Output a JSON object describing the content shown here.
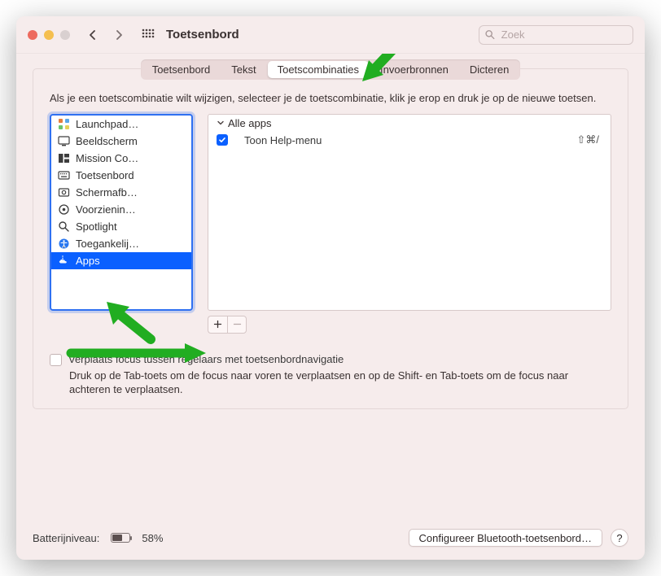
{
  "window": {
    "title": "Toetsenbord"
  },
  "search": {
    "placeholder": "Zoek"
  },
  "tabs": [
    "Toetsenbord",
    "Tekst",
    "Toetscombinaties",
    "Invoerbronnen",
    "Dicteren"
  ],
  "active_tab_index": 2,
  "description": "Als je een toetscombinatie wilt wijzigen, selecteer je de toetscombinatie, klik je erop en druk je op de nieuwe toetsen.",
  "categories": [
    {
      "label": "Launchpad…",
      "icon": "launchpad"
    },
    {
      "label": "Beeldscherm",
      "icon": "display"
    },
    {
      "label": "Mission Co…",
      "icon": "mission"
    },
    {
      "label": "Toetsenbord",
      "icon": "keyboard"
    },
    {
      "label": "Schermafb…",
      "icon": "screenshot"
    },
    {
      "label": "Voorzienin…",
      "icon": "services"
    },
    {
      "label": "Spotlight",
      "icon": "spotlight"
    },
    {
      "label": "Toegankelij…",
      "icon": "accessibility"
    },
    {
      "label": "Apps",
      "icon": "apps",
      "selected": true
    }
  ],
  "shortcuts": {
    "group": "Alle apps",
    "items": [
      {
        "checked": true,
        "label": "Toon Help-menu",
        "shortcut": "⇧⌘/"
      }
    ]
  },
  "focus": {
    "checkbox_label": "Verplaats focus tussen regelaars met toetsenbordnavigatie",
    "desc": "Druk op de Tab-toets om de focus naar voren te verplaatsen en op de Shift- en Tab-toets om de focus naar achteren te verplaatsen."
  },
  "footer": {
    "battery_label": "Batterijniveau:",
    "battery_pct": "58%",
    "bluetooth_button": "Configureer Bluetooth-toetsenbord…"
  }
}
